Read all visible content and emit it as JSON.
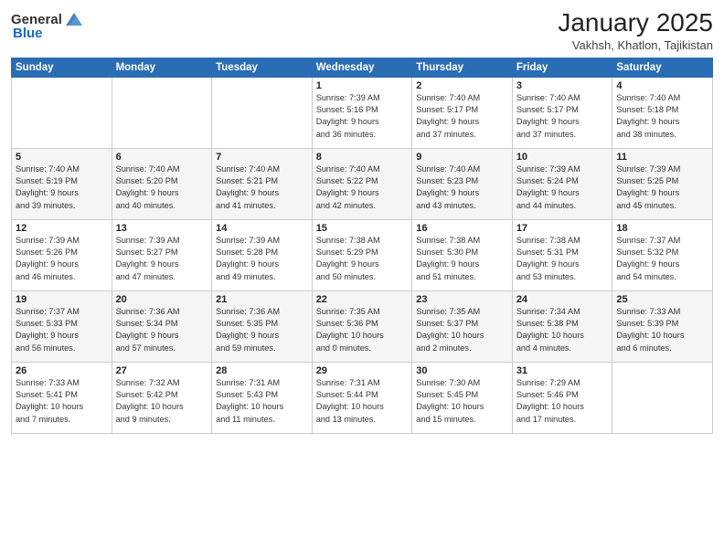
{
  "header": {
    "logo_general": "General",
    "logo_blue": "Blue",
    "title": "January 2025",
    "location": "Vakhsh, Khatlon, Tajikistan"
  },
  "days_of_week": [
    "Sunday",
    "Monday",
    "Tuesday",
    "Wednesday",
    "Thursday",
    "Friday",
    "Saturday"
  ],
  "weeks": [
    [
      {
        "day": "",
        "info": ""
      },
      {
        "day": "",
        "info": ""
      },
      {
        "day": "",
        "info": ""
      },
      {
        "day": "1",
        "info": "Sunrise: 7:39 AM\nSunset: 5:16 PM\nDaylight: 9 hours\nand 36 minutes."
      },
      {
        "day": "2",
        "info": "Sunrise: 7:40 AM\nSunset: 5:17 PM\nDaylight: 9 hours\nand 37 minutes."
      },
      {
        "day": "3",
        "info": "Sunrise: 7:40 AM\nSunset: 5:17 PM\nDaylight: 9 hours\nand 37 minutes."
      },
      {
        "day": "4",
        "info": "Sunrise: 7:40 AM\nSunset: 5:18 PM\nDaylight: 9 hours\nand 38 minutes."
      }
    ],
    [
      {
        "day": "5",
        "info": "Sunrise: 7:40 AM\nSunset: 5:19 PM\nDaylight: 9 hours\nand 39 minutes."
      },
      {
        "day": "6",
        "info": "Sunrise: 7:40 AM\nSunset: 5:20 PM\nDaylight: 9 hours\nand 40 minutes."
      },
      {
        "day": "7",
        "info": "Sunrise: 7:40 AM\nSunset: 5:21 PM\nDaylight: 9 hours\nand 41 minutes."
      },
      {
        "day": "8",
        "info": "Sunrise: 7:40 AM\nSunset: 5:22 PM\nDaylight: 9 hours\nand 42 minutes."
      },
      {
        "day": "9",
        "info": "Sunrise: 7:40 AM\nSunset: 5:23 PM\nDaylight: 9 hours\nand 43 minutes."
      },
      {
        "day": "10",
        "info": "Sunrise: 7:39 AM\nSunset: 5:24 PM\nDaylight: 9 hours\nand 44 minutes."
      },
      {
        "day": "11",
        "info": "Sunrise: 7:39 AM\nSunset: 5:25 PM\nDaylight: 9 hours\nand 45 minutes."
      }
    ],
    [
      {
        "day": "12",
        "info": "Sunrise: 7:39 AM\nSunset: 5:26 PM\nDaylight: 9 hours\nand 46 minutes."
      },
      {
        "day": "13",
        "info": "Sunrise: 7:39 AM\nSunset: 5:27 PM\nDaylight: 9 hours\nand 47 minutes."
      },
      {
        "day": "14",
        "info": "Sunrise: 7:39 AM\nSunset: 5:28 PM\nDaylight: 9 hours\nand 49 minutes."
      },
      {
        "day": "15",
        "info": "Sunrise: 7:38 AM\nSunset: 5:29 PM\nDaylight: 9 hours\nand 50 minutes."
      },
      {
        "day": "16",
        "info": "Sunrise: 7:38 AM\nSunset: 5:30 PM\nDaylight: 9 hours\nand 51 minutes."
      },
      {
        "day": "17",
        "info": "Sunrise: 7:38 AM\nSunset: 5:31 PM\nDaylight: 9 hours\nand 53 minutes."
      },
      {
        "day": "18",
        "info": "Sunrise: 7:37 AM\nSunset: 5:32 PM\nDaylight: 9 hours\nand 54 minutes."
      }
    ],
    [
      {
        "day": "19",
        "info": "Sunrise: 7:37 AM\nSunset: 5:33 PM\nDaylight: 9 hours\nand 56 minutes."
      },
      {
        "day": "20",
        "info": "Sunrise: 7:36 AM\nSunset: 5:34 PM\nDaylight: 9 hours\nand 57 minutes."
      },
      {
        "day": "21",
        "info": "Sunrise: 7:36 AM\nSunset: 5:35 PM\nDaylight: 9 hours\nand 59 minutes."
      },
      {
        "day": "22",
        "info": "Sunrise: 7:35 AM\nSunset: 5:36 PM\nDaylight: 10 hours\nand 0 minutes."
      },
      {
        "day": "23",
        "info": "Sunrise: 7:35 AM\nSunset: 5:37 PM\nDaylight: 10 hours\nand 2 minutes."
      },
      {
        "day": "24",
        "info": "Sunrise: 7:34 AM\nSunset: 5:38 PM\nDaylight: 10 hours\nand 4 minutes."
      },
      {
        "day": "25",
        "info": "Sunrise: 7:33 AM\nSunset: 5:39 PM\nDaylight: 10 hours\nand 6 minutes."
      }
    ],
    [
      {
        "day": "26",
        "info": "Sunrise: 7:33 AM\nSunset: 5:41 PM\nDaylight: 10 hours\nand 7 minutes."
      },
      {
        "day": "27",
        "info": "Sunrise: 7:32 AM\nSunset: 5:42 PM\nDaylight: 10 hours\nand 9 minutes."
      },
      {
        "day": "28",
        "info": "Sunrise: 7:31 AM\nSunset: 5:43 PM\nDaylight: 10 hours\nand 11 minutes."
      },
      {
        "day": "29",
        "info": "Sunrise: 7:31 AM\nSunset: 5:44 PM\nDaylight: 10 hours\nand 13 minutes."
      },
      {
        "day": "30",
        "info": "Sunrise: 7:30 AM\nSunset: 5:45 PM\nDaylight: 10 hours\nand 15 minutes."
      },
      {
        "day": "31",
        "info": "Sunrise: 7:29 AM\nSunset: 5:46 PM\nDaylight: 10 hours\nand 17 minutes."
      },
      {
        "day": "",
        "info": ""
      }
    ]
  ]
}
